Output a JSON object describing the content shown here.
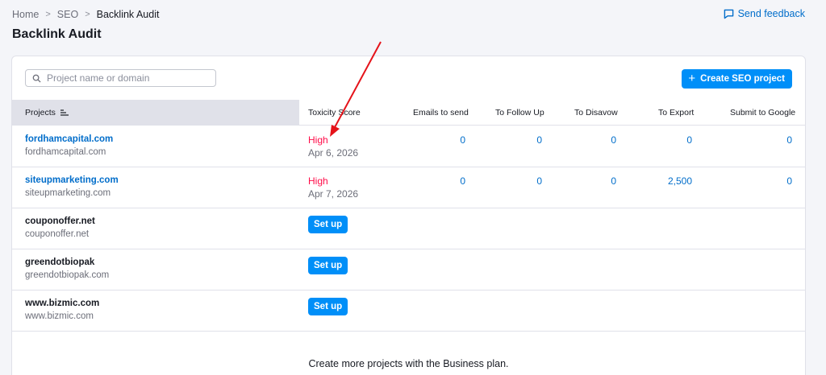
{
  "breadcrumb": {
    "items": [
      "Home",
      "SEO",
      "Backlink Audit"
    ],
    "separator": ">"
  },
  "page_title": "Backlink Audit",
  "feedback_label": "Send feedback",
  "search": {
    "placeholder": "Project name or domain",
    "value": ""
  },
  "create_button": {
    "label": "Create SEO project",
    "icon": "plus-icon"
  },
  "table": {
    "columns": [
      "Projects",
      "Toxicity Score",
      "Emails to send",
      "To Follow Up",
      "To Disavow",
      "To Export",
      "Submit to Google"
    ],
    "rows": [
      {
        "name": "fordhamcapital.com",
        "domain": "fordhamcapital.com",
        "toxicity": "High",
        "date": "Apr 6, 2026",
        "emails": "0",
        "follow_up": "0",
        "disavow": "0",
        "export": "0",
        "submit": "0"
      },
      {
        "name": "siteupmarketing.com",
        "domain": "siteupmarketing.com",
        "toxicity": "High",
        "date": "Apr 7, 2026",
        "emails": "0",
        "follow_up": "0",
        "disavow": "0",
        "export": "2,500",
        "submit": "0"
      },
      {
        "name": "couponoffer.net",
        "domain": "couponoffer.net",
        "setup_label": "Set up"
      },
      {
        "name": "greendotbiopak",
        "domain": "greendotbiopak.com",
        "setup_label": "Set up"
      },
      {
        "name": "www.bizmic.com",
        "domain": "www.bizmic.com",
        "setup_label": "Set up"
      }
    ]
  },
  "footer_text": "Create more projects with the Business plan.",
  "colors": {
    "accent": "#008ff8",
    "link": "#006dca",
    "toxic": "#ff0b48",
    "annotation": "#e5131a"
  }
}
